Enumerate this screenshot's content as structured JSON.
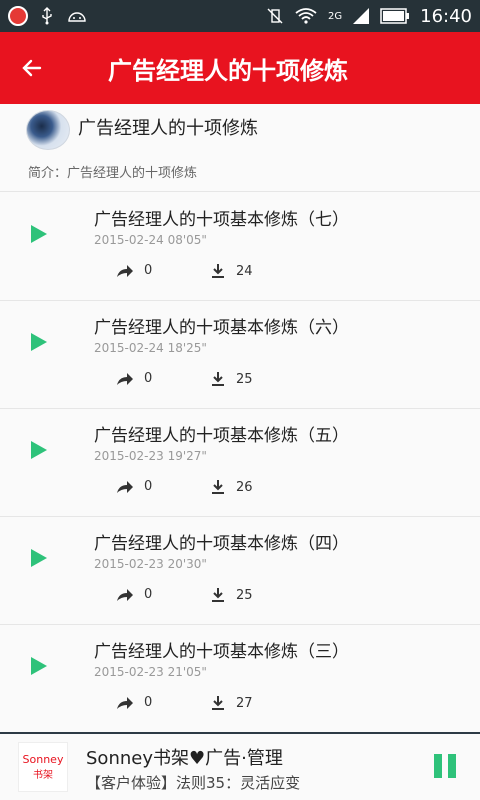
{
  "status_bar": {
    "time": "16:40",
    "network": "2G"
  },
  "app_bar": {
    "title": "广告经理人的十项修炼",
    "back_icon": "arrow-left-icon"
  },
  "album": {
    "title": "广告经理人的十项修炼",
    "intro": "简介：广告经理人的十项修炼"
  },
  "episodes": [
    {
      "title": "广告经理人的十项基本修炼（七）",
      "date": "2015-02-24",
      "duration": "08'05\"",
      "shares": "0",
      "downloads": "24"
    },
    {
      "title": "广告经理人的十项基本修炼（六）",
      "date": "2015-02-24",
      "duration": "18'25\"",
      "shares": "0",
      "downloads": "25"
    },
    {
      "title": "广告经理人的十项基本修炼（五）",
      "date": "2015-02-23",
      "duration": "19'27\"",
      "shares": "0",
      "downloads": "26"
    },
    {
      "title": "广告经理人的十项基本修炼（四）",
      "date": "2015-02-23",
      "duration": "20'30\"",
      "shares": "0",
      "downloads": "25"
    },
    {
      "title": "广告经理人的十项基本修炼（三）",
      "date": "2015-02-23",
      "duration": "21'05\"",
      "shares": "0",
      "downloads": "27"
    }
  ],
  "player": {
    "title": "Sonney书架♥广告·管理",
    "subtitle": "【客户体验】法则35：灵活应变",
    "art_brand": "Sonney",
    "art_brand2": "书架"
  },
  "colors": {
    "primary": "#e8131f",
    "play": "#2ec27a",
    "status_bar": "#263238"
  }
}
